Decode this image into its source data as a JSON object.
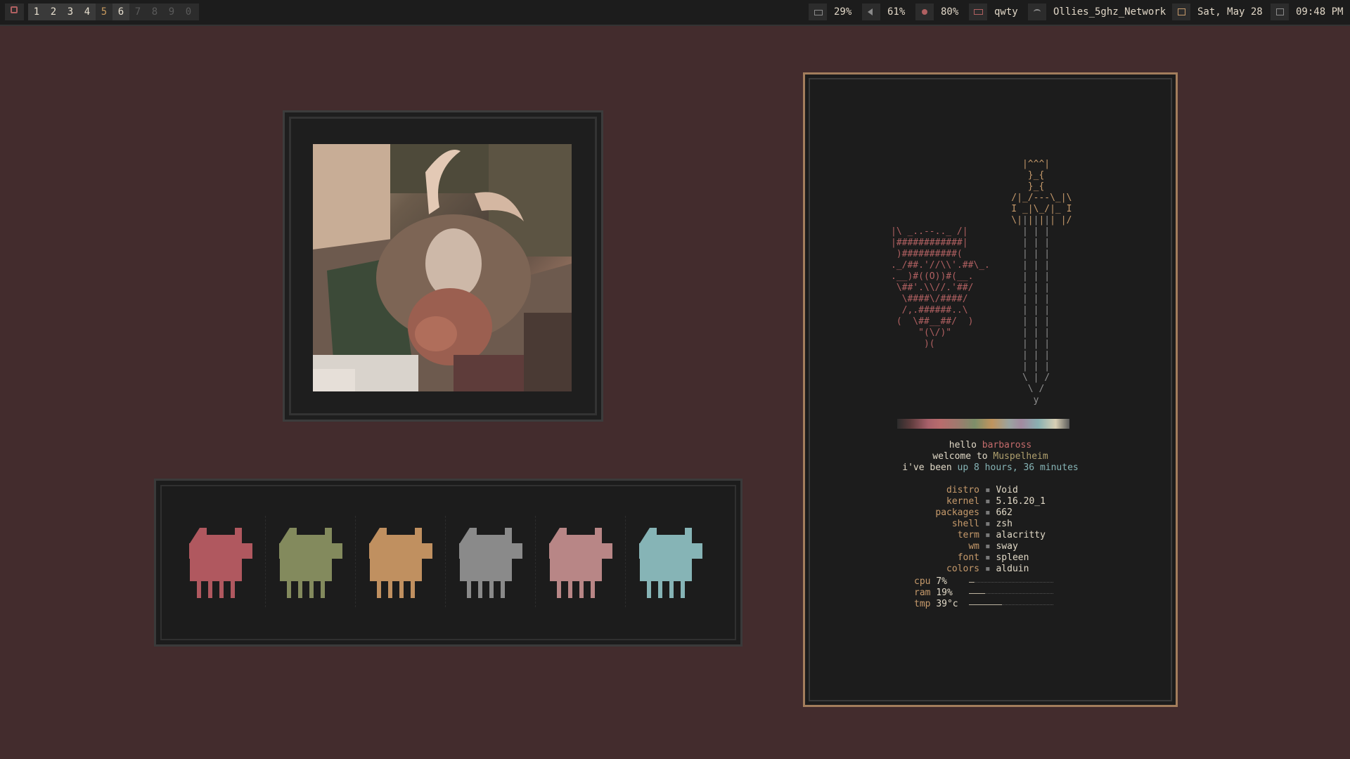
{
  "bar": {
    "workspaces": [
      {
        "label": "1",
        "state": "occupied"
      },
      {
        "label": "2",
        "state": "occupied"
      },
      {
        "label": "3",
        "state": "occupied"
      },
      {
        "label": "4",
        "state": "occupied"
      },
      {
        "label": "5",
        "state": "active"
      },
      {
        "label": "6",
        "state": "occupied"
      },
      {
        "label": "7",
        "state": "empty"
      },
      {
        "label": "8",
        "state": "empty"
      },
      {
        "label": "9",
        "state": "empty"
      },
      {
        "label": "0",
        "state": "empty"
      }
    ],
    "battery": "29%",
    "volume": "61%",
    "brightness": "80%",
    "keyboard": "qwty",
    "wifi": "Ollies_5ghz_Network",
    "date": "Sat, May 28",
    "time": "09:48 PM"
  },
  "palette": [
    {
      "name": "red",
      "color": "#b0585f"
    },
    {
      "name": "green",
      "color": "#838a5d"
    },
    {
      "name": "orange",
      "color": "#c09060"
    },
    {
      "name": "grey",
      "color": "#8a8a8a"
    },
    {
      "name": "pink",
      "color": "#b88686"
    },
    {
      "name": "cyan",
      "color": "#86b4b6"
    }
  ],
  "fetch": {
    "greeting": {
      "hello": "hello",
      "user": "barbaross",
      "welcome": "welcome to",
      "host": "Muspelheim",
      "been": "i've been",
      "uptime": "up 8 hours, 36 minutes"
    },
    "info": [
      {
        "key": "distro",
        "value": "Void"
      },
      {
        "key": "kernel",
        "value": "5.16.20_1"
      },
      {
        "key": "packages",
        "value": "662"
      },
      {
        "key": "shell",
        "value": "zsh"
      },
      {
        "key": "term",
        "value": "alacritty"
      },
      {
        "key": "wm",
        "value": "sway"
      },
      {
        "key": "font",
        "value": "spleen"
      },
      {
        "key": "colors",
        "value": "alduin"
      }
    ],
    "meters": [
      {
        "key": "cpu",
        "value": "7%",
        "fraction": 0.07
      },
      {
        "key": "ram",
        "value": "19%",
        "fraction": 0.19
      },
      {
        "key": "tmp",
        "value": "39°c",
        "fraction": 0.39
      }
    ],
    "ascii_helmet": "|\\ _..--.._ /|\n|############|\n )##########(\n._/##.'//\\\\'.##\\_.\n.__)#((O))#(__.\n \\##'.\\\\//.'##/\n  \\####\\/####/\n  /,.######..\\\n (  \\##__##/  )\n     \"(\\/)\"\n      )(",
    "ascii_sword_hilt": "      |^^^|\n       }_{\n       }_{\n    /|_/---\\_|\\\n    I _|\\_/|_ I\n    \\| | | | |/",
    "ascii_sword_blade": "      | | |\n      | | |\n      | | |\n      | | |\n      | | |\n      | | |\n      | | |\n      | | |\n      | | |\n      | | |\n      | | |\n      | | |\n      | | |\n      | | |\n      \\ | /\n       \\ /\n        y"
  }
}
